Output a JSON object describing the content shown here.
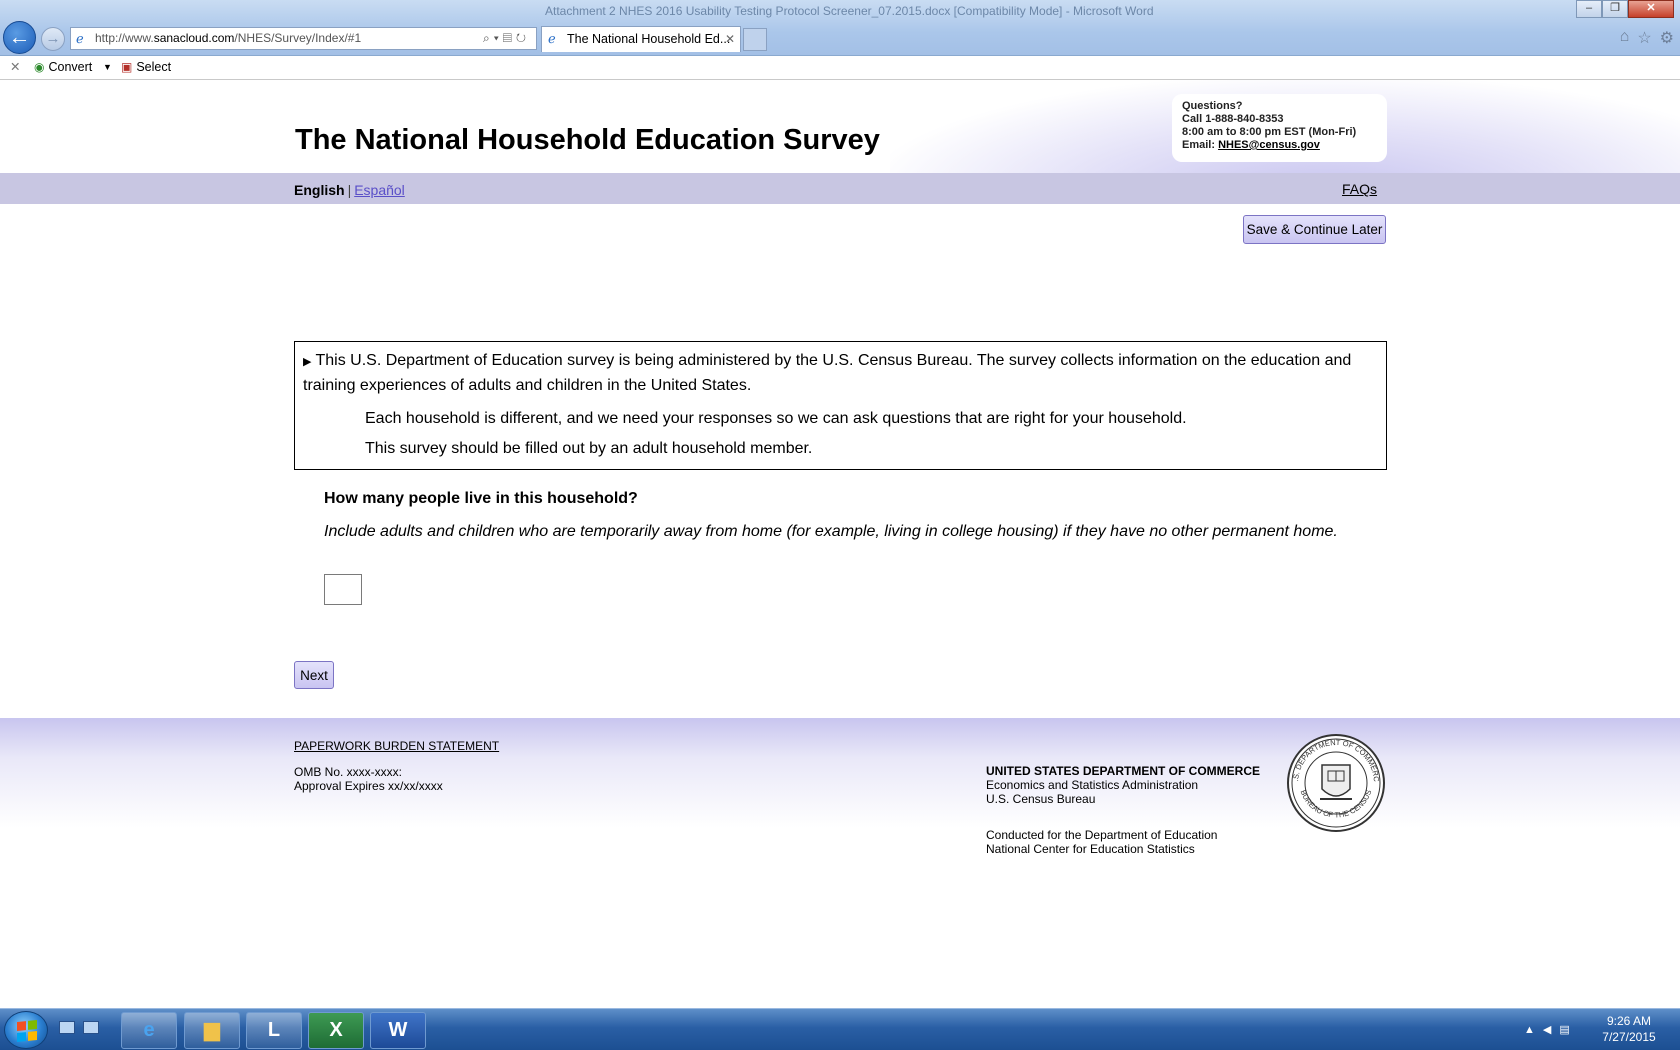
{
  "browser": {
    "window_title": "Attachment 2 NHES 2016 Usability Testing Protocol Screener_07.2015.docx [Compatibility Mode] - Microsoft Word",
    "url_prefix": "http://www.",
    "url_host": "sanacloud.com",
    "url_path": "/NHES/Survey/Index/#1",
    "tab_title": "The National Household Ed...",
    "commandbar": {
      "convert_label": "Convert",
      "select_label": "Select"
    }
  },
  "header": {
    "title": "The National Household Education Survey",
    "contact": {
      "heading": "Questions?",
      "phone": "Call 1-888-840-8353",
      "hours": "8:00 am to 8:00 pm EST (Mon-Fri)",
      "email_label": "Email: ",
      "email": "NHES@census.gov"
    },
    "languages": {
      "english": "English",
      "separator": "|",
      "spanish": "Español"
    },
    "faqs_label": "FAQs"
  },
  "actions": {
    "save_label": "Save & Continue Later",
    "next_label": "Next"
  },
  "intro": {
    "paragraph1": "This U.S. Department of Education survey is being administered by the U.S. Census Bureau. The survey collects information on the education and training experiences of adults and children in the United States.",
    "paragraph2": "Each household is different, and we need your responses so we can ask questions that are right for your household.",
    "paragraph3": "This survey should be filled out by an adult household member."
  },
  "question": {
    "text": "How many people live in this household?",
    "hint": "Include adults and children who are temporarily away from home (for example, living in college housing) if they have no other permanent home.",
    "answer_value": ""
  },
  "footer": {
    "burden_link": "PAPERWORK BURDEN STATEMENT",
    "omb_number": "OMB No. xxxx-xxxx:",
    "approval": "Approval Expires xx/xx/xxxx",
    "commerce_title": "UNITED STATES DEPARTMENT OF COMMERCE",
    "commerce_line2": "Economics and Statistics Administration",
    "commerce_line3": "U.S. Census Bureau",
    "conducted_line1": "Conducted for the Department of Education",
    "conducted_line2": "National Center for Education Statistics",
    "seal_text_top": "U.S. DEPARTMENT OF COMMERCE",
    "seal_text_bottom": "BUREAU OF THE CENSUS"
  },
  "taskbar": {
    "time": "9:26 AM",
    "date": "7/27/2015"
  },
  "icons": [
    "back-arrow-icon",
    "forward-arrow-icon",
    "ie-page-icon",
    "search-icon",
    "refresh-icon",
    "home-icon",
    "favorites-star-icon",
    "settings-gear-icon",
    "convert-icon",
    "select-icon",
    "start-orb-icon",
    "census-seal"
  ]
}
